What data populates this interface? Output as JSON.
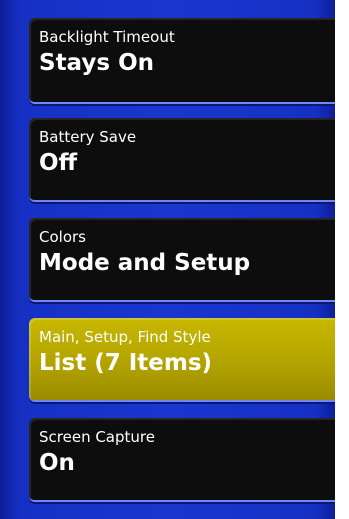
{
  "menu": {
    "items": [
      {
        "label": "Backlight Timeout",
        "value": "Stays On",
        "selected": false
      },
      {
        "label": "Battery Save",
        "value": "Off",
        "selected": false
      },
      {
        "label": "Colors",
        "value": "Mode and Setup",
        "selected": false
      },
      {
        "label": "Main, Setup, Find Style",
        "value": "List (7 Items)",
        "selected": true
      },
      {
        "label": "Screen Capture",
        "value": "On",
        "selected": false
      }
    ]
  },
  "colors": {
    "background_blue": "#1a36cf",
    "item_background": "#0d0d0d",
    "selected_highlight": "#b3a300",
    "text": "#ffffff"
  }
}
